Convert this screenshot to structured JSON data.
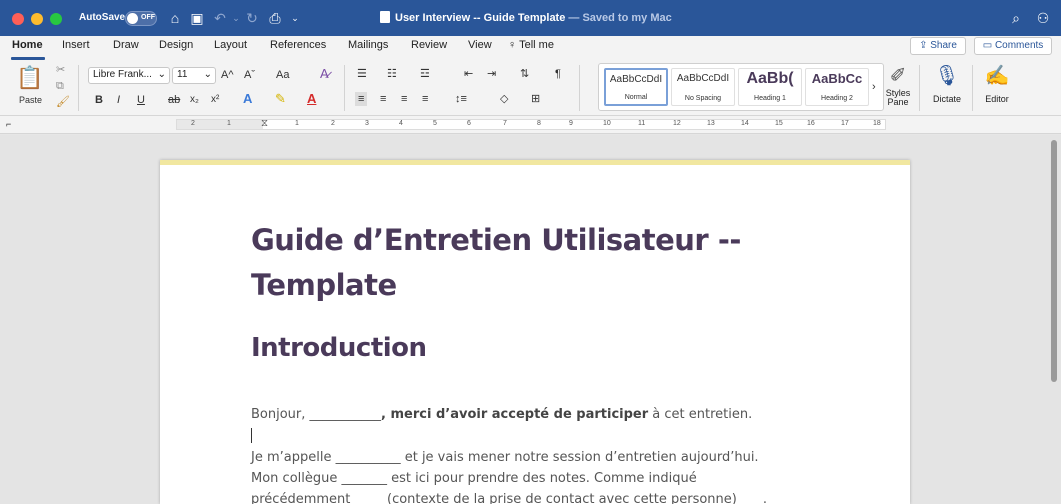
{
  "titlebar": {
    "autosave_label": "AutoSave",
    "autosave_state": "OFF",
    "doc_title": "User Interview -- Guide Template",
    "saved_status": "— Saved to my Mac",
    "icons": [
      "home-icon",
      "save-icon",
      "undo-icon",
      "redo-icon",
      "print-icon",
      "search-icon",
      "share-people-icon"
    ]
  },
  "tabs": [
    "Home",
    "Insert",
    "Draw",
    "Design",
    "Layout",
    "References",
    "Mailings",
    "Review",
    "View"
  ],
  "tell_me": "Tell me",
  "share_label": "Share",
  "comments_label": "Comments",
  "ribbon": {
    "paste_label": "Paste",
    "font_name": "Libre Frank...",
    "font_size": "11",
    "grow_font": "A^",
    "shrink_font": "Aˇ",
    "change_case": "Aa",
    "bold": "B",
    "italic": "I",
    "underline": "U",
    "strike": "ab",
    "subscript": "x₂",
    "superscript": "x²",
    "styles": [
      {
        "sample": "AaBbCcDdI",
        "name": "Normal"
      },
      {
        "sample": "AaBbCcDdI",
        "name": "No Spacing"
      },
      {
        "sample": "AaBb(",
        "name": "Heading 1"
      },
      {
        "sample": "AaBbCc",
        "name": "Heading 2"
      }
    ],
    "styles_pane_label": "Styles Pane",
    "dictate_label": "Dictate",
    "editor_label": "Editor"
  },
  "ruler": {
    "numbers": [
      "2",
      "1",
      "1",
      "2",
      "3",
      "4",
      "5",
      "6",
      "7",
      "8",
      "9",
      "10",
      "11",
      "12",
      "13",
      "14",
      "15",
      "16",
      "17",
      "18"
    ]
  },
  "document": {
    "title": "Guide d’Entretien Utilisateur -- Template",
    "heading": "Introduction",
    "line1_pre": "Bonjour, ___________",
    "line1_bold": ", merci d’avoir accepté de participer",
    "line1_post": " à cet entretien.",
    "line2": "Je m’appelle __________ et je vais mener notre session d’entretien aujourd’hui.",
    "line3": "Mon collègue _______ est ici pour prendre des notes. Comme indiqué",
    "line4": "précédemment_____ (contexte de la prise de contact avec cette personne)____."
  }
}
